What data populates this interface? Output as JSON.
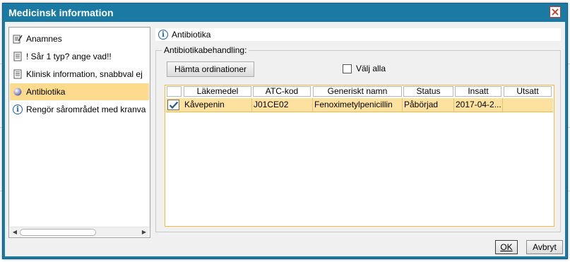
{
  "window": {
    "title": "Medicinsk information"
  },
  "nav": {
    "items": [
      {
        "label": "Anamnes",
        "icon": "edit-note-icon"
      },
      {
        "label": "! Sår 1 typ? ange vad!!",
        "icon": "document-list-icon"
      },
      {
        "label": "Klinisk information, snabbval ej",
        "icon": "document-list-icon"
      },
      {
        "label": "Antibiotika",
        "icon": "sphere-icon",
        "selected": true
      },
      {
        "label": "Rengör sårområdet med kranva",
        "icon": "info-icon"
      }
    ]
  },
  "panel": {
    "header_title": "Antibiotika",
    "group_label": "Antibiotikabehandling:",
    "fetch_button": "Hämta ordinationer",
    "select_all_label": "Välj alla",
    "select_all_checked": false
  },
  "grid": {
    "columns": [
      "Läkemedel",
      "ATC-kod",
      "Generiskt namn",
      "Status",
      "Insatt",
      "Utsatt"
    ],
    "rows": [
      {
        "checked": true,
        "cells": [
          "Kåvepenin",
          "J01CE02",
          "Fenoximetylpenicillin",
          "Påbörjad",
          "2017-04-2...",
          ""
        ]
      }
    ]
  },
  "buttons": {
    "ok": "OK",
    "cancel": "Avbryt"
  },
  "colors": {
    "titlebar": "#1a7aa3",
    "selection": "#fddb8e",
    "row_highlight": "#fde29f",
    "close": "#c23b2b"
  }
}
